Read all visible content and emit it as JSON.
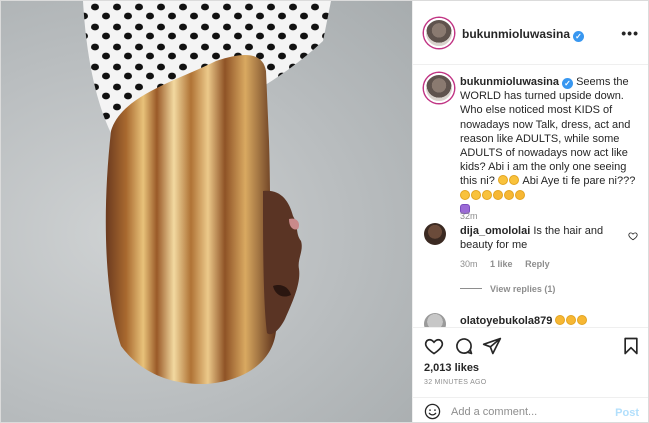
{
  "header": {
    "username": "bukunmioluwasina",
    "verified": true,
    "more_icon": "more-horizontal-icon"
  },
  "caption": {
    "username": "bukunmioluwasina",
    "text_main": "Seems the WORLD has turned upside down. Who else noticed most KIDS of nowadays now Talk, dress, act and reason like ADULTS, while some ADULTS of nowadays now act like kids? Abi i am the only one seeing this ni?",
    "text_tail": "Abi Aye ti fe pare ni???",
    "time": "32m"
  },
  "comments": [
    {
      "username": "dija_omololai",
      "text": "Is the hair and beauty for me",
      "time": "30m",
      "likes": "1 like",
      "reply": "Reply",
      "view_replies": "View replies (1)"
    },
    {
      "username": "olatoyebukola879",
      "text": ""
    }
  ],
  "actions": {
    "like_icon": "heart-icon",
    "comment_icon": "comment-icon",
    "share_icon": "paper-plane-icon",
    "save_icon": "bookmark-icon",
    "likes": "2,013 likes",
    "time_ago": "32 MINUTES AGO"
  },
  "add_comment": {
    "placeholder": "Add a comment...",
    "post_label": "Post",
    "emoji_icon": "smiley-icon"
  },
  "colors": {
    "verified_blue": "#3897f0",
    "post_disabled": "#b2dffc",
    "muted_text": "#8e8e8e",
    "border": "#efefef"
  }
}
